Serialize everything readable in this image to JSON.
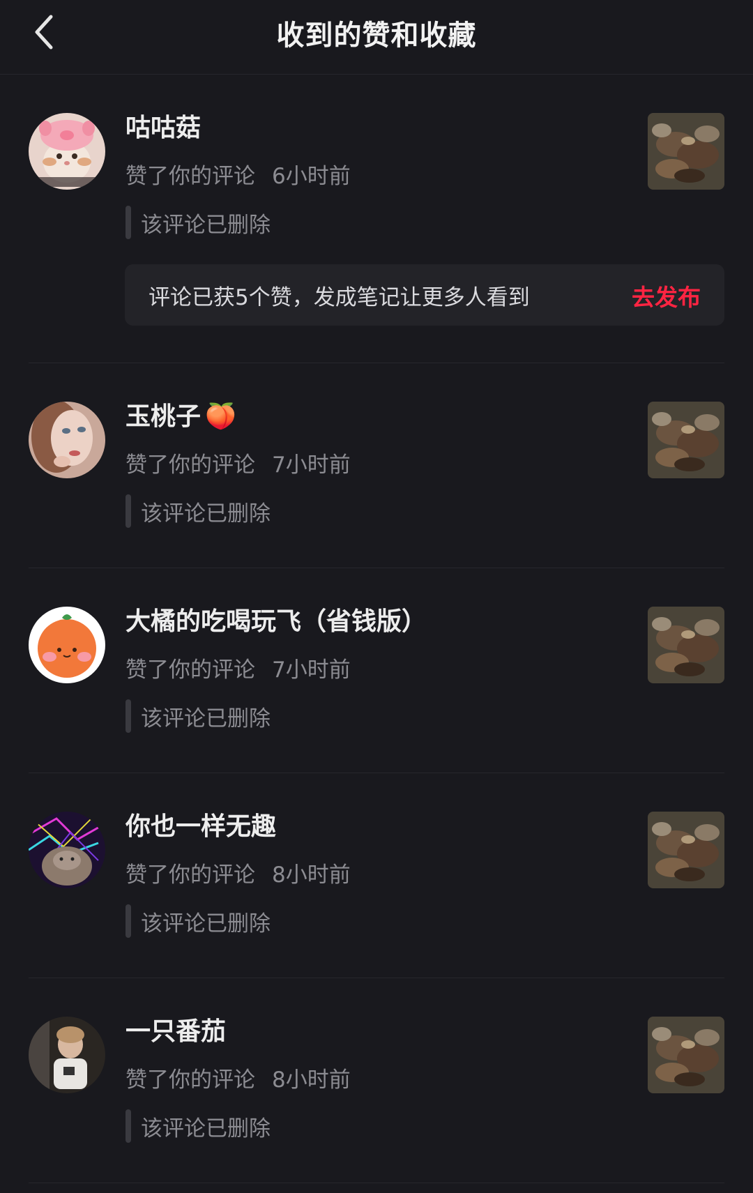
{
  "header": {
    "title": "收到的赞和收藏",
    "back_icon": "chevron-left-icon"
  },
  "notifications": [
    {
      "username": "咕咕菇",
      "action": "赞了你的评论",
      "time": "6小时前",
      "quote": "该评论已删除",
      "promo": {
        "text": "评论已获5个赞，发成笔记让更多人看到",
        "button": "去发布"
      }
    },
    {
      "username": "玉桃子",
      "emoji": "🍑",
      "action": "赞了你的评论",
      "time": "7小时前",
      "quote": "该评论已删除"
    },
    {
      "username": "大橘的吃喝玩飞（省钱版）",
      "action": "赞了你的评论",
      "time": "7小时前",
      "quote": "该评论已删除"
    },
    {
      "username": "你也一样无趣",
      "action": "赞了你的评论",
      "time": "8小时前",
      "quote": "该评论已删除"
    },
    {
      "username": "一只番茄",
      "action": "赞了你的评论",
      "time": "8小时前",
      "quote": "该评论已删除"
    }
  ],
  "colors": {
    "background": "#19191e",
    "accent": "#ff2442",
    "secondary_text": "#8c8c92"
  }
}
